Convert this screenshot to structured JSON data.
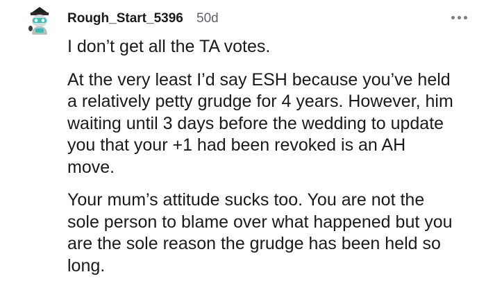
{
  "comment": {
    "username": "Rough_Start_5396",
    "age": "50d",
    "more_icon": "ellipsis-icon",
    "avatar_icon": "snoo-avatar-icon",
    "paragraphs": [
      "I don’t get all the TA votes.",
      "At the very least I’d say ESH because you’ve held a relatively petty grudge for 4 years. However, him waiting until 3 days before the wedding to update you that your +1 had been revoked is an AH move.",
      "Your mum’s attitude sucks too. You are not the sole person to blame over what happened but you are the sole reason the grudge has been held so long."
    ]
  },
  "colors": {
    "text": "#1a1a1b",
    "meta": "#5f6368",
    "icon": "#7c7c7c",
    "avatar_accent": "#2ec4b6"
  }
}
